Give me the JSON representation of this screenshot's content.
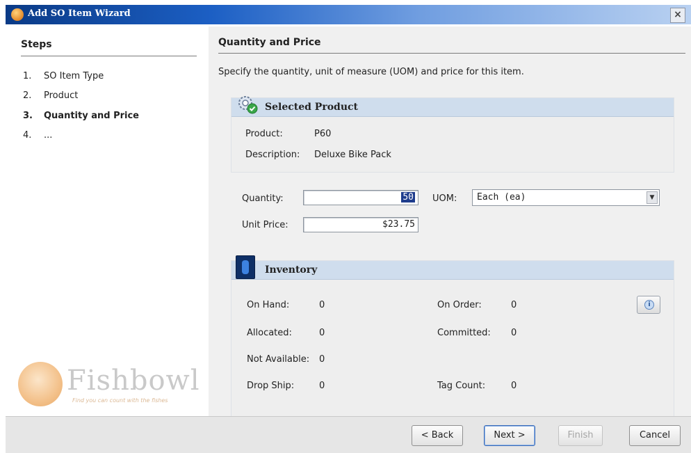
{
  "window": {
    "title": "Add SO Item Wizard",
    "close_glyph": "×"
  },
  "steps": {
    "title": "Steps",
    "items": [
      {
        "num": "1.",
        "label": "SO Item Type"
      },
      {
        "num": "2.",
        "label": "Product"
      },
      {
        "num": "3.",
        "label": "Quantity and Price"
      },
      {
        "num": "4.",
        "label": "..."
      }
    ],
    "active_index": 2
  },
  "branding": {
    "logo_text": "Fishbowl",
    "tagline": "Find you can count with the fishes"
  },
  "section": {
    "title": "Quantity and Price",
    "instruction": "Specify the quantity, unit of measure (UOM) and price for this item."
  },
  "selected_product": {
    "header": "Selected Product",
    "product_label": "Product:",
    "product_value": "P60",
    "description_label": "Description:",
    "description_value": "Deluxe Bike Pack"
  },
  "form": {
    "quantity_label": "Quantity:",
    "quantity_value": "50",
    "uom_label": "UOM:",
    "uom_value": "Each (ea)",
    "unit_price_label": "Unit Price:",
    "unit_price_value": "$23.75"
  },
  "inventory": {
    "header": "Inventory",
    "on_hand_label": "On Hand:",
    "on_hand_value": "0",
    "on_order_label": "On Order:",
    "on_order_value": "0",
    "allocated_label": "Allocated:",
    "allocated_value": "0",
    "committed_label": "Committed:",
    "committed_value": "0",
    "not_available_label": "Not Available:",
    "not_available_value": "0",
    "drop_ship_label": "Drop Ship:",
    "drop_ship_value": "0",
    "tag_count_label": "Tag Count:",
    "tag_count_value": "0",
    "info_glyph": "i"
  },
  "buttons": {
    "back": "< Back",
    "next": "Next >",
    "finish": "Finish",
    "cancel": "Cancel"
  },
  "colors": {
    "titlebar": "#0a3a86",
    "group_header": "#cfdded",
    "selection": "#1e3c8c"
  }
}
